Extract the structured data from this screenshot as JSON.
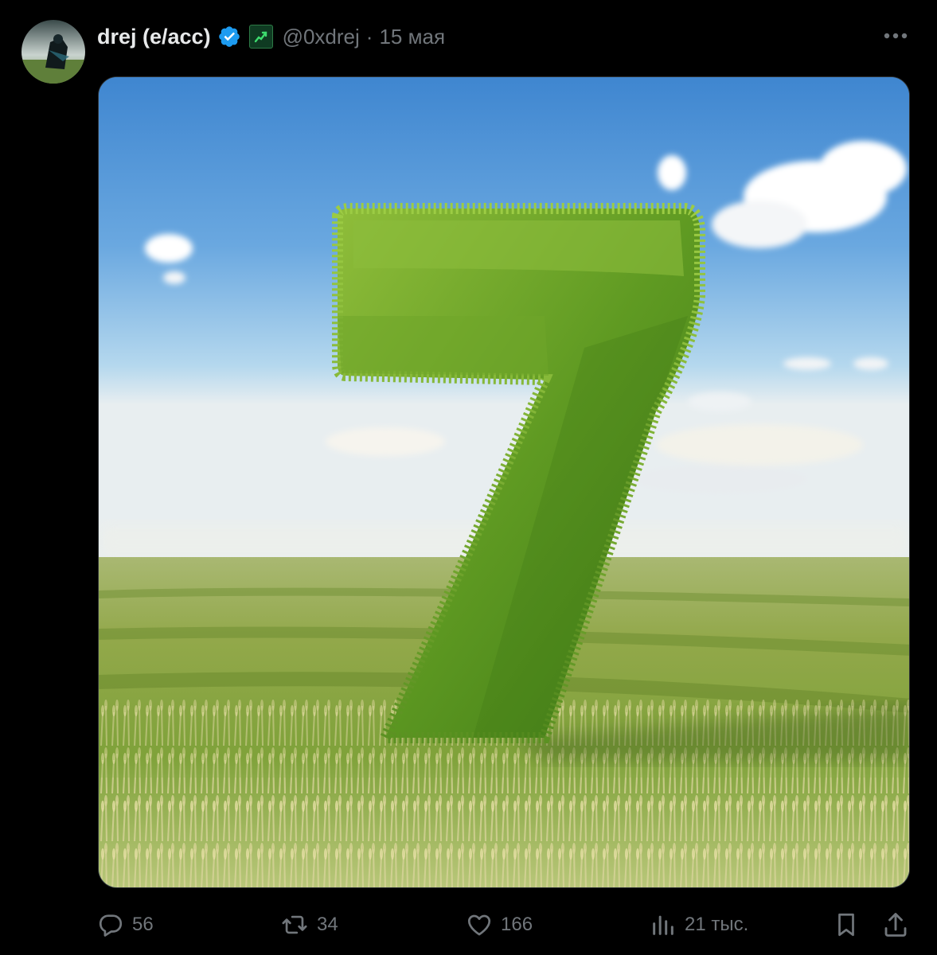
{
  "author": {
    "name": "drej (e/acc)",
    "handle": "@0xdrej",
    "separator": "·",
    "date": "15 мая"
  },
  "colors": {
    "background": "#000000",
    "text": "#e7e9ea",
    "muted": "#71767b",
    "verified": "#1d9bf0",
    "badge": "#0f3b22"
  },
  "actions": {
    "reply_count": "56",
    "repost_count": "34",
    "like_count": "166",
    "views_count": "21 тыс."
  },
  "icons": [
    "more-icon",
    "verified-icon",
    "badge-icon",
    "reply-icon",
    "repost-icon",
    "like-icon",
    "views-icon",
    "bookmark-icon",
    "share-icon"
  ]
}
